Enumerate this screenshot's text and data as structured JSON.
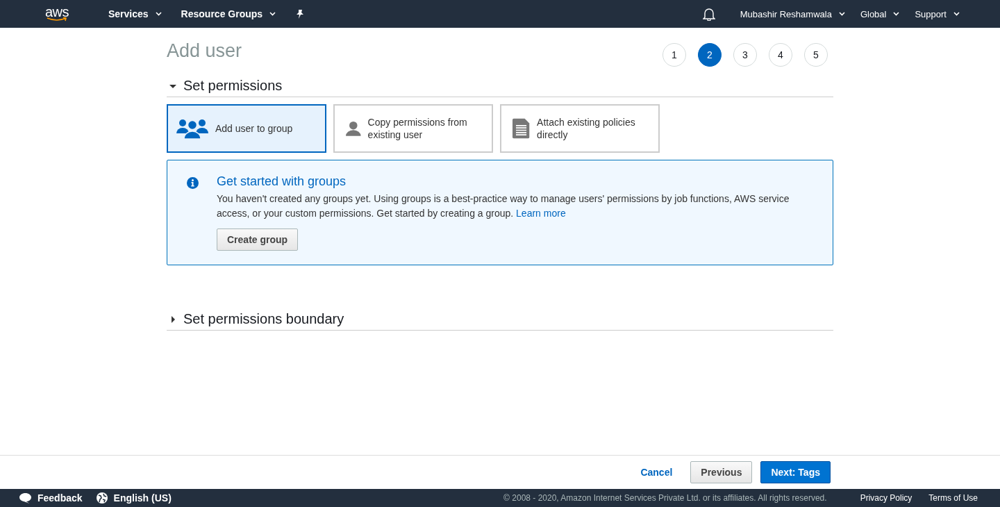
{
  "top_nav": {
    "logo": "aws",
    "menus": [
      {
        "label": "Services"
      },
      {
        "label": "Resource Groups"
      }
    ],
    "right_menus": [
      {
        "label": "Mubashir Reshamwala"
      },
      {
        "label": "Global"
      },
      {
        "label": "Support"
      }
    ]
  },
  "page": {
    "title": "Add user",
    "steps": [
      {
        "label": "1",
        "selected": false
      },
      {
        "label": "2",
        "selected": true
      },
      {
        "label": "3",
        "selected": false
      },
      {
        "label": "4",
        "selected": false
      },
      {
        "label": "5",
        "selected": false
      }
    ]
  },
  "sections": [
    {
      "title": "Set permissions",
      "expanded": true
    },
    {
      "title": "Set permissions boundary",
      "expanded": false
    }
  ],
  "options": [
    {
      "label": "Add user to group",
      "kind": "group",
      "selected": true
    },
    {
      "label": "Copy permissions from existing user",
      "kind": "user",
      "selected": false
    },
    {
      "label": "Attach existing policies directly",
      "kind": "document",
      "selected": false
    }
  ],
  "info": {
    "title": "Get started with groups",
    "text": "You haven't created any groups yet. Using groups is a best-practice way to manage users' permissions by job functions, AWS service access, or your custom permissions. Get started by creating a group.",
    "link": "Learn more",
    "button": "Create group"
  },
  "actions": {
    "cancel": "Cancel",
    "previous": "Previous",
    "next": "Next: Tags"
  },
  "footer": {
    "feedback": "Feedback",
    "language": "English (US)",
    "copyright": "© 2008 - 2020, Amazon Internet Services Private Ltd. or its affiliates. All rights reserved.",
    "links": [
      "Privacy Policy",
      "Terms of Use"
    ]
  }
}
